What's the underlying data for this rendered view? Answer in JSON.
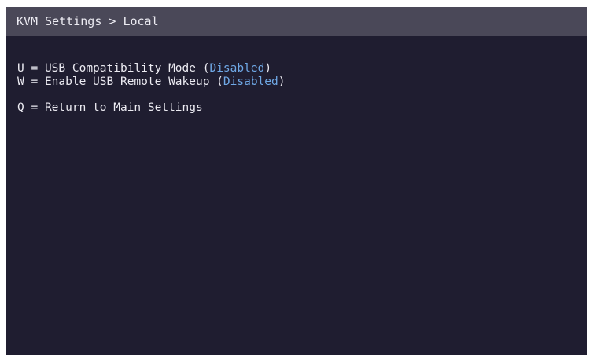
{
  "header": {
    "title": "KVM Settings > Local"
  },
  "menu": {
    "items": [
      {
        "key": "U",
        "separator": " = ",
        "label": "USB Compatibility Mode",
        "open_paren": " (",
        "status": "Disabled",
        "close_paren": ")"
      },
      {
        "key": "W",
        "separator": " = ",
        "label": "Enable USB Remote Wakeup",
        "open_paren": " (",
        "status": "Disabled",
        "close_paren": ")"
      }
    ],
    "return_item": {
      "key": "Q",
      "separator": " = ",
      "label": "Return to Main Settings"
    }
  },
  "colors": {
    "background": "#1f1d30",
    "titlebar": "#4a4858",
    "text": "#ecebf2",
    "status": "#6fa8e6"
  }
}
